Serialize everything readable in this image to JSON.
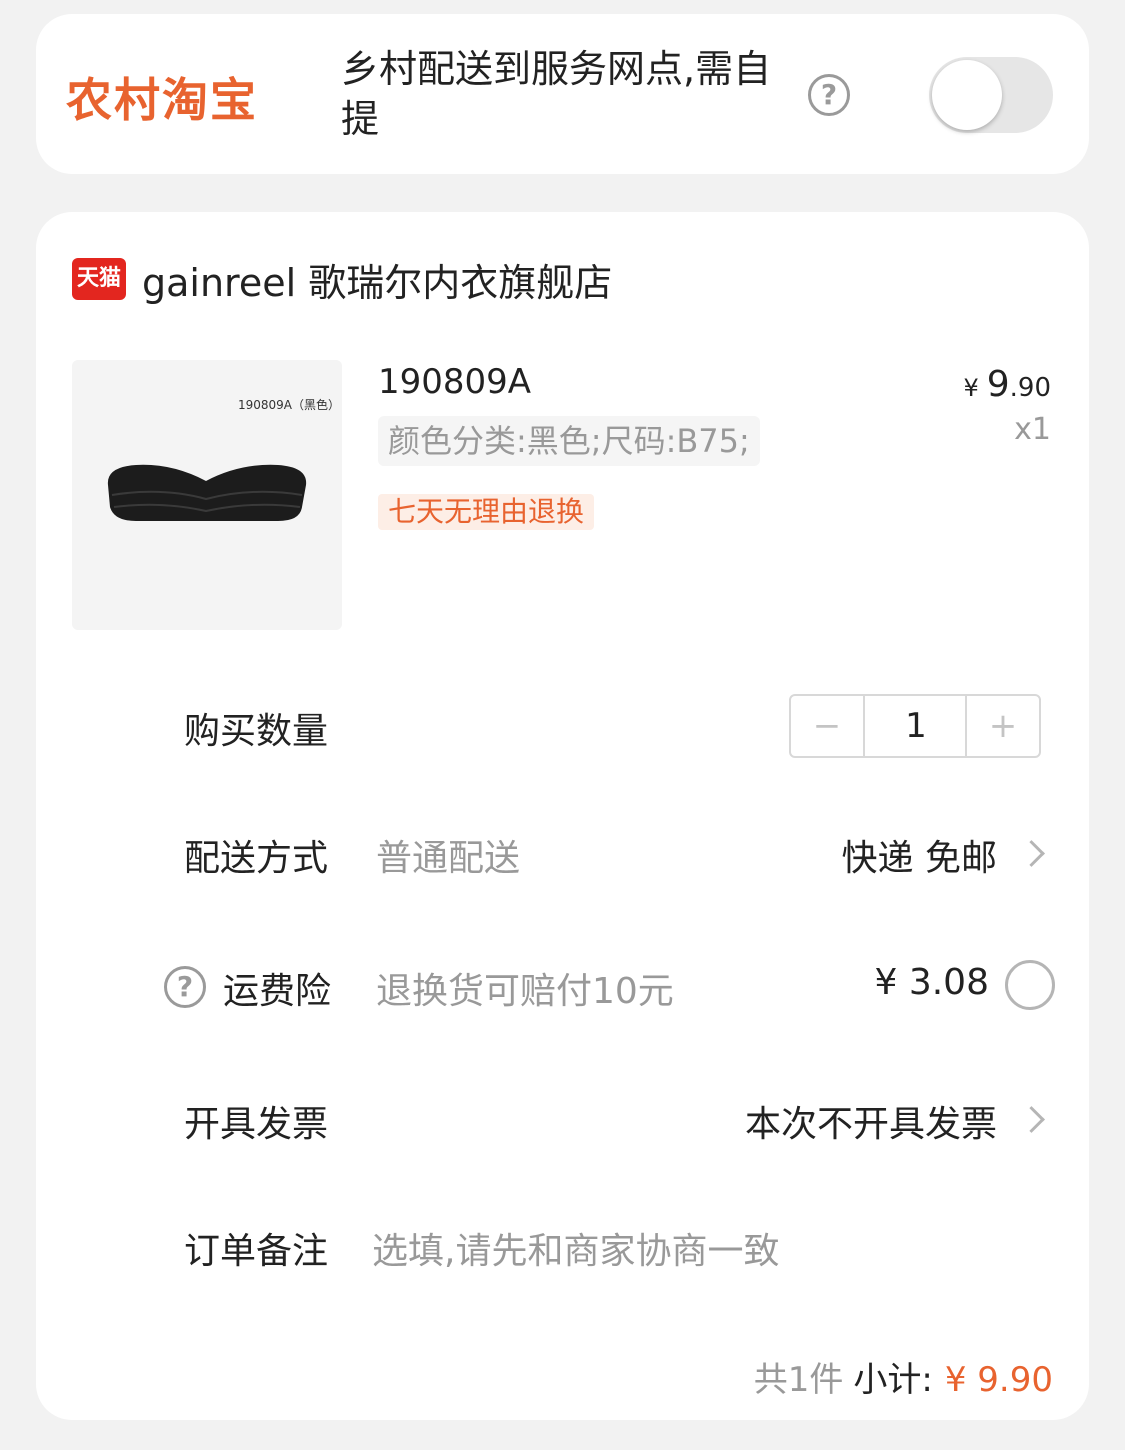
{
  "rural": {
    "logo_text": "农村淘宝",
    "text": "乡村配送到服务网点,需自提",
    "help_icon": "?",
    "toggle_on": false
  },
  "shop": {
    "badge_text": "天猫",
    "name": "gainreel 歌瑞尔内衣旗舰店"
  },
  "product": {
    "thumb_code": "190809A（黑色）",
    "title": "190809A",
    "sku": "颜色分类:黑色;尺码:B75;",
    "tag": "七天无理由退换",
    "price_currency": "¥",
    "price_int": "9",
    "price_dec": ".90",
    "qty_text": "x1"
  },
  "quantity": {
    "label": "购买数量",
    "minus": "−",
    "value": "1",
    "plus": "+"
  },
  "delivery": {
    "label": "配送方式",
    "sub": "普通配送",
    "value": "快递 免邮"
  },
  "insurance": {
    "help_icon": "?",
    "label": "运费险",
    "sub": "退换货可赔付10元",
    "price": "¥ 3.08",
    "selected": false
  },
  "invoice": {
    "label": "开具发票",
    "value": "本次不开具发票"
  },
  "note": {
    "label": "订单备注",
    "placeholder": "选填,请先和商家协商一致"
  },
  "footer": {
    "count": "共1件",
    "subtotal_label": "小计:",
    "subtotal_value": "¥ 9.90"
  },
  "colors": {
    "accent": "#e8632f",
    "tmall_red": "#e3261f"
  }
}
